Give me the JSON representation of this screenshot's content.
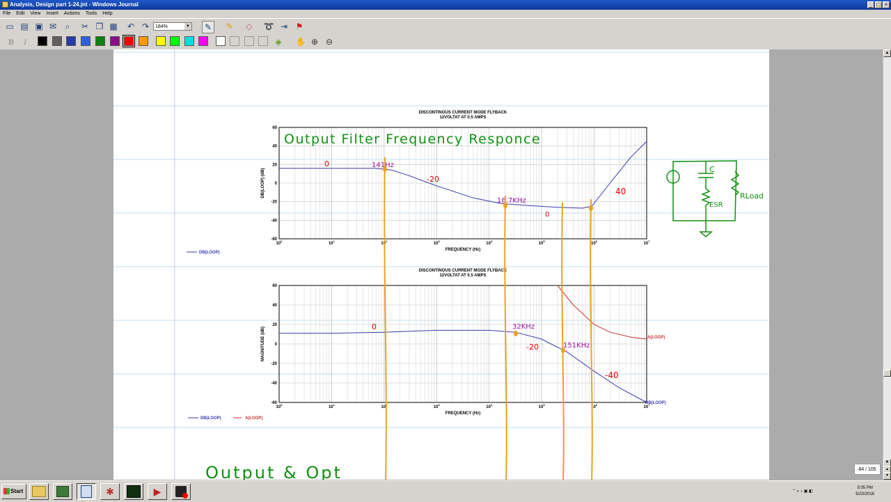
{
  "window": {
    "title": "Analysis, Design part 1-24.jnt - Windows Journal"
  },
  "menu": [
    "File",
    "Edit",
    "View",
    "Insert",
    "Actions",
    "Tools",
    "Help"
  ],
  "toolbar": {
    "zoom": "184%"
  },
  "palette": [
    "#000000",
    "#606060",
    "#2a3aa8",
    "#3060e0",
    "#108010",
    "#8a0a8a",
    "#ff0000",
    "#ff9900",
    "#ffff00",
    "#00ff00",
    "#00e0e0",
    "#ff00ff",
    "#ffffff"
  ],
  "chart1": {
    "title": "DISCONTINOUS CURRENT MODE FLYBACK",
    "subtitle": "12VOLTAT AT 0.5 AMPS",
    "ylabel": "DB(LOOP) (dB)",
    "xlabel": "FREQUENCY   (Hz)",
    "yticks": [
      "60",
      "40",
      "20",
      "0",
      "-20",
      "-40",
      "-60"
    ],
    "legend": "DB(LOOP)"
  },
  "chart2": {
    "title": "DISCONTINOUS CURRENT MODE FLYBACK",
    "subtitle": "12VOLTAT AT 0.5 AMPS",
    "ylabel": "MAGNITUDE (dB)",
    "xlabel": "FREQUENCY   (Hz)",
    "yticks": [
      "60",
      "40",
      "20",
      "0",
      "-20",
      "-40",
      "-60"
    ],
    "legend_db": "DB(LOOP)",
    "legend_a": "A(LOOP)",
    "label_a": "A(LOOP)",
    "label_db": "DB(LOOP)"
  },
  "chart_data": [
    {
      "type": "line",
      "title": "DISCONTINOUS CURRENT MODE FLYBACK",
      "subtitle": "12VOLTAT AT 0.5 AMPS",
      "xlabel": "FREQUENCY (Hz)",
      "ylabel": "DB(LOOP) (dB)",
      "xscale": "log",
      "xlim": [
        1,
        10000000
      ],
      "ylim": [
        -60,
        60
      ],
      "grid": true,
      "series": [
        {
          "name": "DB(LOOP)",
          "color": "#3a3ab0",
          "x": [
            1,
            10,
            70,
            140,
            300,
            1000,
            5000,
            16700,
            50000,
            200000,
            600000,
            900000,
            2000000,
            5000000,
            10000000
          ],
          "y": [
            16,
            16,
            16,
            14,
            8,
            -3,
            -16,
            -22,
            -24,
            -26,
            -27,
            -25,
            0,
            28,
            45
          ]
        }
      ]
    },
    {
      "type": "line",
      "title": "DISCONTINOUS CURRENT MODE FLYBACK",
      "subtitle": "12VOLTAT AT 0.5 AMPS",
      "xlabel": "FREQUENCY (Hz)",
      "ylabel": "MAGNITUDE (dB)",
      "xscale": "log",
      "xlim": [
        1,
        10000000
      ],
      "ylim": [
        -60,
        60
      ],
      "grid": true,
      "series": [
        {
          "name": "DB(LOOP)",
          "color": "#3a3ab0",
          "x": [
            1,
            10,
            100,
            300,
            1000,
            10000,
            32000,
            100000,
            150000,
            300000,
            1000000,
            3000000,
            10000000
          ],
          "y": [
            11,
            11,
            12,
            13,
            14,
            14,
            12,
            5,
            0,
            -8,
            -28,
            -45,
            -60
          ]
        },
        {
          "name": "A(LOOP)",
          "color": "#d03030",
          "x": [
            200000,
            400000,
            1000000,
            2000000,
            5000000,
            10000000
          ],
          "y": [
            60,
            40,
            20,
            12,
            7,
            5
          ]
        }
      ]
    }
  ],
  "annotations": {
    "heading": "Output Filter Frequency Responce",
    "c1_zero": "0",
    "c1_f1": "141Hz",
    "c1_slope1": "-20",
    "c1_f2": "16.7KHz",
    "c1_zero2": "0",
    "c1_slope2": "40",
    "c2_zero": "0",
    "c2_f1": "32KHz",
    "c2_slope1": "-20",
    "c2_f2": "151KHz",
    "c2_slope2": "-40",
    "bottom": "Output & Opt",
    "circuit_c": "C",
    "circuit_esr": "ESR",
    "circuit_rload": "RLoad"
  },
  "status": {
    "page": "84 / 105",
    "time": "5:05 PM",
    "date": "5/20/2018"
  },
  "taskbar": {
    "start": "Start"
  }
}
